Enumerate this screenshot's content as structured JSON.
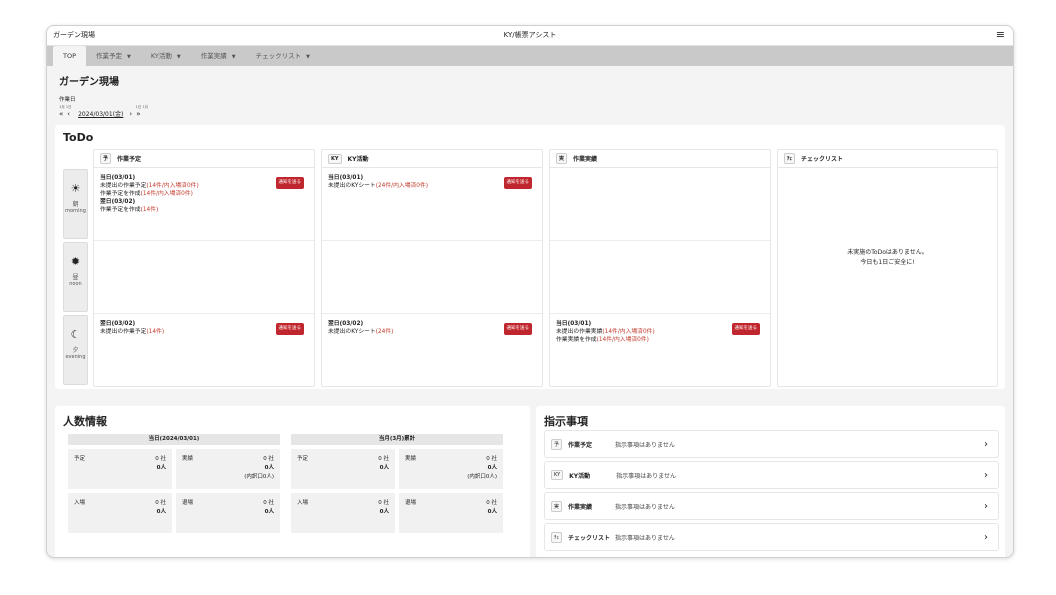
{
  "header": {
    "app_name": "ガーデン現場",
    "brand": "KY/帳票アシスト",
    "menu_icon": "hamburger-menu-icon"
  },
  "nav": [
    {
      "label": "TOP",
      "active": true,
      "has_caret": false
    },
    {
      "label": "作業予定",
      "active": false,
      "has_caret": true
    },
    {
      "label": "KY活動",
      "active": false,
      "has_caret": true
    },
    {
      "label": "作業実績",
      "active": false,
      "has_caret": true
    },
    {
      "label": "チェックリスト",
      "active": false,
      "has_caret": true
    }
  ],
  "page": {
    "title": "ガーデン現場",
    "date_label": "作業日",
    "date_value": "2024/03/01(金)",
    "prev_month": "«",
    "prev_day": "‹",
    "next_day": "›",
    "next_month": "»",
    "ruby_prev_month": "1月",
    "ruby_prev_day": "1日",
    "ruby_next_day": "1日",
    "ruby_next_month": "1月"
  },
  "todo": {
    "title": "ToDo",
    "time_slots": [
      {
        "jp": "朝",
        "en": "morning",
        "icon": "sunrise-icon"
      },
      {
        "jp": "昼",
        "en": "noon",
        "icon": "sun-icon"
      },
      {
        "jp": "夕",
        "en": "evening",
        "icon": "moon-icon"
      }
    ],
    "notify_label": "通知を送る",
    "columns": [
      {
        "tag": "予",
        "name": "作業予定",
        "morning": {
          "lines": [
            {
              "text": "当日(03/01)",
              "bold": true
            },
            {
              "text": "未提出の作業予定",
              "red": "(14件/内入場済0件)"
            },
            {
              "text": "作業予定を作成",
              "red": "(14件/内入場済0件)"
            },
            {
              "text": "翌日(03/02)",
              "bold": true
            },
            {
              "text": "作業予定を作成",
              "red": "(14件)"
            }
          ],
          "notify": true
        },
        "noon": {
          "lines": [],
          "notify": false
        },
        "evening": {
          "lines": [
            {
              "text": "翌日(03/02)",
              "bold": true
            },
            {
              "text": "未提出の作業予定",
              "red": "(14件)"
            }
          ],
          "notify": true
        }
      },
      {
        "tag": "KY",
        "name": "KY活動",
        "morning": {
          "lines": [
            {
              "text": "当日(03/01)",
              "bold": true
            },
            {
              "text": "未提出のKYシート",
              "red": "(24件/内入場済0件)"
            }
          ],
          "notify": true
        },
        "noon": {
          "lines": [],
          "notify": false
        },
        "evening": {
          "lines": [
            {
              "text": "翌日(03/02)",
              "bold": true
            },
            {
              "text": "未提出のKYシート",
              "red": "(24件)"
            }
          ],
          "notify": true
        }
      },
      {
        "tag": "実",
        "name": "作業実績",
        "morning": {
          "lines": [],
          "notify": false
        },
        "noon": {
          "lines": [],
          "notify": false
        },
        "evening": {
          "lines": [
            {
              "text": "当日(03/01)",
              "bold": true
            },
            {
              "text": "未提出の作業実績",
              "red": "(14件/内入場済0件)"
            },
            {
              "text": "作業実績を作成",
              "red": "(14件/内入場済0件)"
            }
          ],
          "notify": true
        }
      },
      {
        "tag": "ﾁｪ",
        "name": "チェックリスト",
        "empty_line1": "未実施のToDoはありません。",
        "empty_line2": "今日も1日ご安全に!"
      }
    ]
  },
  "persons": {
    "title": "人数情報",
    "groups": [
      {
        "header": "当日(2024/03/01)",
        "cells": [
          {
            "label": "予定",
            "v1": "0 社",
            "v2": "0人",
            "v3": ""
          },
          {
            "label": "実績",
            "v1": "0 社",
            "v2": "0人",
            "v3": "(内訳口0人)"
          },
          {
            "label": "入場",
            "v1": "0 社",
            "v2": "0人",
            "v3": ""
          },
          {
            "label": "退場",
            "v1": "0 社",
            "v2": "0人",
            "v3": ""
          }
        ]
      },
      {
        "header": "当月(3月)累計",
        "cells": [
          {
            "label": "予定",
            "v1": "0 社",
            "v2": "0人",
            "v3": ""
          },
          {
            "label": "実績",
            "v1": "0 社",
            "v2": "0人",
            "v3": "(内訳口0人)"
          },
          {
            "label": "入場",
            "v1": "0 社",
            "v2": "0人",
            "v3": ""
          },
          {
            "label": "退場",
            "v1": "0 社",
            "v2": "0人",
            "v3": ""
          }
        ]
      }
    ]
  },
  "instructions": {
    "title": "指示事項",
    "items": [
      {
        "tag": "予",
        "category": "作業予定",
        "message": "指示事項はありません"
      },
      {
        "tag": "KY",
        "category": "KY活動",
        "message": "指示事項はありません"
      },
      {
        "tag": "実",
        "category": "作業実績",
        "message": "指示事項はありません"
      },
      {
        "tag": "ﾁｪ",
        "category": "チェックリスト",
        "message": "指示事項はありません"
      }
    ]
  },
  "colors": {
    "accent_red": "#c0262d",
    "nav_bg": "#c9c9c9"
  }
}
